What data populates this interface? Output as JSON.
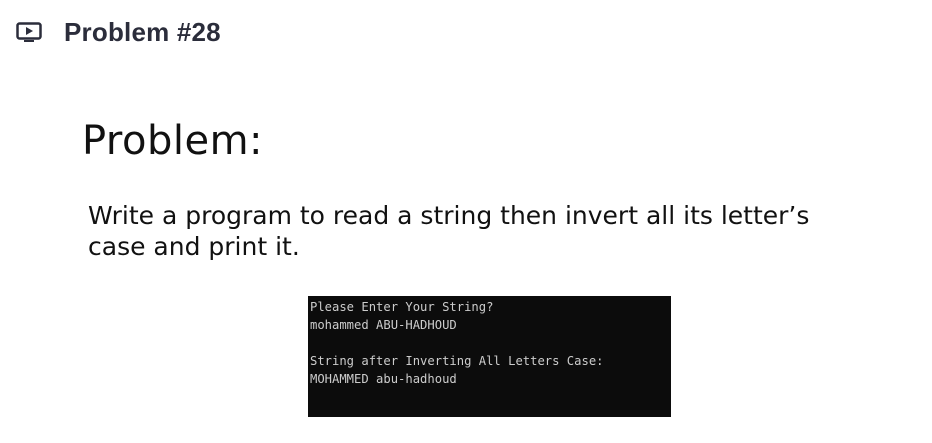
{
  "header": {
    "icon": "play-screen-icon",
    "title": "Problem #28"
  },
  "slide": {
    "heading": "Problem:",
    "description_line1": "Write a program to read a string then invert all its letter’s",
    "description_line2": "case and print it."
  },
  "console": {
    "lines": [
      "Please Enter Your String?",
      "mohammed ABU-HADHOUD",
      "",
      "String after Inverting All Letters Case:",
      "MOHAMMED abu-hadhoud"
    ]
  }
}
